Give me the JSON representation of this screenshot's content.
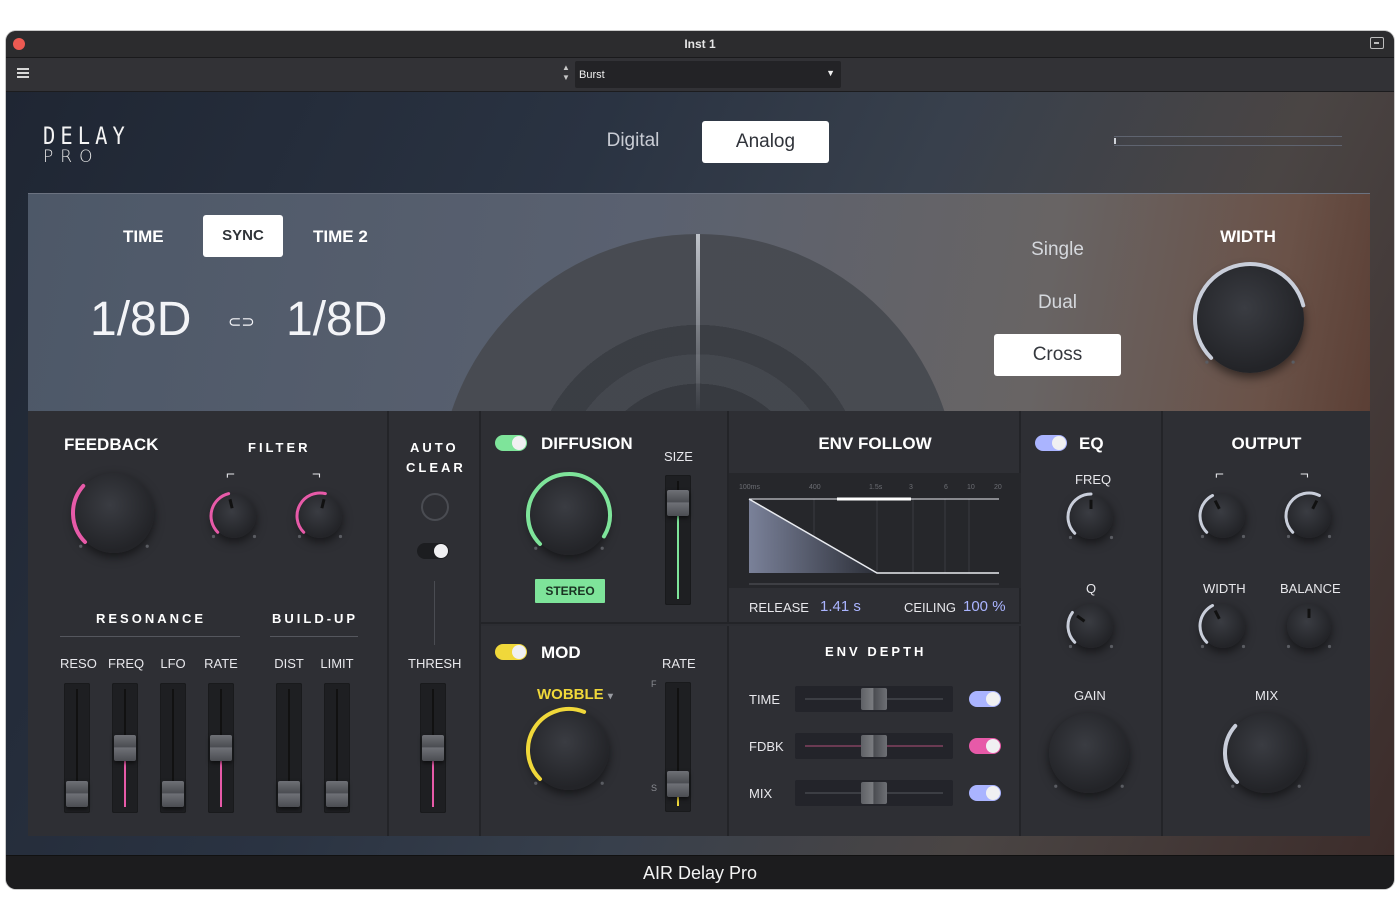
{
  "window": {
    "title": "Inst 1",
    "plugin_name": "AIR Delay Pro"
  },
  "toolbar": {
    "preset_name": "Burst",
    "stepper_up": "▲",
    "stepper_down": "▼",
    "dropdown_arrow": "▼"
  },
  "header": {
    "logo_line1": "DELAY",
    "logo_line2": "PRO",
    "modes": [
      {
        "label": "Digital",
        "selected": false
      },
      {
        "label": "Analog",
        "selected": true
      }
    ]
  },
  "time": {
    "time_label": "TIME",
    "sync_label": "SYNC",
    "time2_label": "TIME 2",
    "value1": "1/8D",
    "value2": "1/8D",
    "link_icon": "⊂⊃"
  },
  "stereo_mode": {
    "options": [
      "Single",
      "Dual",
      "Cross"
    ],
    "selected": "Cross"
  },
  "width": {
    "label": "WIDTH",
    "level": 0.78
  },
  "feedback": {
    "label": "FEEDBACK",
    "level": 0.32,
    "filter_label": "FILTER",
    "filter_lo_level": 0.45,
    "filter_hi_level": 0.55,
    "resonance_label": "RESONANCE",
    "buildup_label": "BUILD-UP",
    "faders": [
      {
        "label": "RESO",
        "level": 0.0
      },
      {
        "label": "FREQ",
        "level": 0.5
      },
      {
        "label": "LFO",
        "level": 0.0
      },
      {
        "label": "RATE",
        "level": 0.5
      },
      {
        "label": "DIST",
        "level": 0.0
      },
      {
        "label": "LIMIT",
        "level": 0.0
      }
    ]
  },
  "auto_clear": {
    "label_line1": "AUTO",
    "label_line2": "CLEAR",
    "thresh_label": "THRESH",
    "thresh_level": 0.5
  },
  "diffusion": {
    "label": "DIFFUSION",
    "enabled": true,
    "size_label": "SIZE",
    "size_level": 0.9,
    "stereo_label": "STEREO",
    "level": 0.95
  },
  "mod": {
    "label": "MOD",
    "enabled": true,
    "rate_label": "RATE",
    "rate_level": 0.1,
    "waveform": "WOBBLE",
    "level": 0.58,
    "rate_top": "F",
    "rate_bottom": "S"
  },
  "env_follow": {
    "label": "ENV FOLLOW",
    "axis_ticks": [
      "100ms",
      "400",
      "1.5s",
      "3",
      "6",
      "10",
      "20"
    ],
    "release_label": "RELEASE",
    "release_value": "1.41 s",
    "ceiling_label": "CEILING",
    "ceiling_value": "100 %",
    "env_depth_label": "ENV DEPTH",
    "depth_rows": [
      {
        "label": "TIME",
        "level": 0.5,
        "toggle_color": "#aab4ff"
      },
      {
        "label": "FDBK",
        "level": 0.5,
        "toggle_color": "#e75aa8"
      },
      {
        "label": "MIX",
        "level": 0.5,
        "toggle_color": "#aab4ff"
      }
    ]
  },
  "eq": {
    "label": "EQ",
    "enabled": true,
    "freq_label": "FREQ",
    "q_label": "Q",
    "gain_label": "GAIN",
    "freq_level": 0.5,
    "q_level": 0.3,
    "gain_level": 0.5
  },
  "output": {
    "label": "OUTPUT",
    "width_label": "WIDTH",
    "balance_label": "BALANCE",
    "mix_label": "MIX",
    "lo_level": 0.4,
    "hi_level": 0.6,
    "width_level": 0.4,
    "balance_level": 0.5,
    "mix_level": 0.32
  },
  "colors": {
    "pink": "#e75aa8",
    "green": "#7ee49a",
    "yellow": "#f0d83a",
    "blue": "#aab4ff",
    "white_arc": "#c9ceda"
  }
}
